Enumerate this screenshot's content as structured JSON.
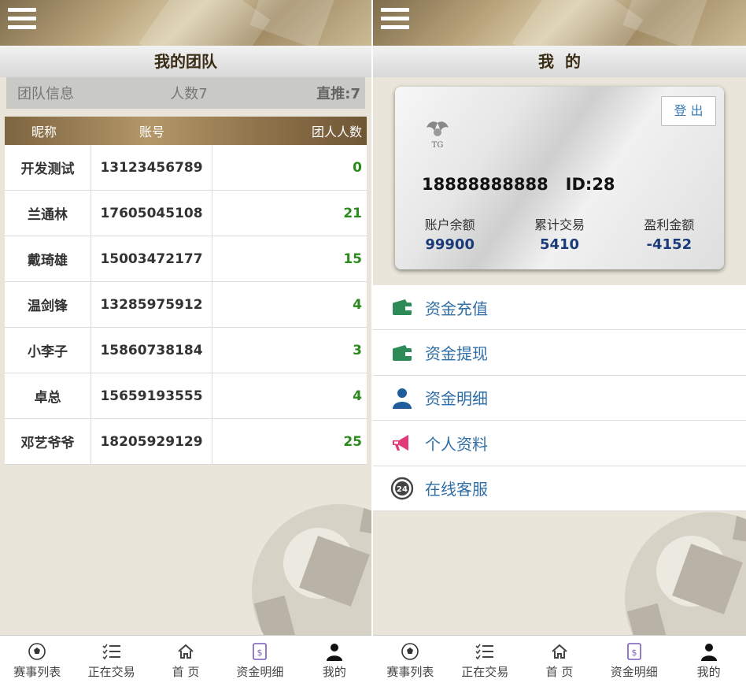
{
  "left": {
    "title": "我的团队",
    "team_info": {
      "label": "团队信息",
      "count": "人数7",
      "direct": "直推:7"
    },
    "table": {
      "headers": [
        "昵称",
        "账号",
        "团人人数"
      ],
      "rows": [
        {
          "nickname": "开发测试",
          "account": "13123456789",
          "count": "0"
        },
        {
          "nickname": "兰通林",
          "account": "17605045108",
          "count": "21"
        },
        {
          "nickname": "戴琦雄",
          "account": "15003472177",
          "count": "15"
        },
        {
          "nickname": "温剑锋",
          "account": "13285975912",
          "count": "4"
        },
        {
          "nickname": "小李子",
          "account": "15860738184",
          "count": "3"
        },
        {
          "nickname": "卓总",
          "account": "15659193555",
          "count": "4"
        },
        {
          "nickname": "邓艺爷爷",
          "account": "18205929129",
          "count": "25"
        }
      ]
    }
  },
  "right": {
    "title": "我  的",
    "card": {
      "logout": "登 出",
      "phone": "18888888888",
      "id": "ID:28",
      "balance_label": "账户余额",
      "balance": "99900",
      "trade_label": "累计交易",
      "trade": "5410",
      "profit_label": "盈利金额",
      "profit": "-4152",
      "emblem_text": "TG"
    },
    "menu": [
      {
        "label": "资金充值",
        "icon": "wallet-icon"
      },
      {
        "label": "资金提现",
        "icon": "wallet-icon"
      },
      {
        "label": "资金明细",
        "icon": "user-icon"
      },
      {
        "label": "个人资料",
        "icon": "megaphone-icon"
      },
      {
        "label": "在线客服",
        "icon": "support-24-icon"
      }
    ]
  },
  "tabbar": {
    "items": [
      {
        "label": "赛事列表",
        "icon": "soccer-ball-icon"
      },
      {
        "label": "正在交易",
        "icon": "checklist-icon"
      },
      {
        "label": "首  页",
        "icon": "home-icon"
      },
      {
        "label": "资金明细",
        "icon": "money-doc-icon"
      },
      {
        "label": "我的",
        "icon": "person-icon"
      }
    ]
  },
  "colors": {
    "accent_gold": "#9f8a63",
    "count_green": "#2a8a1c",
    "link_blue": "#2f6ea6",
    "value_navy": "#1a3a7a"
  }
}
